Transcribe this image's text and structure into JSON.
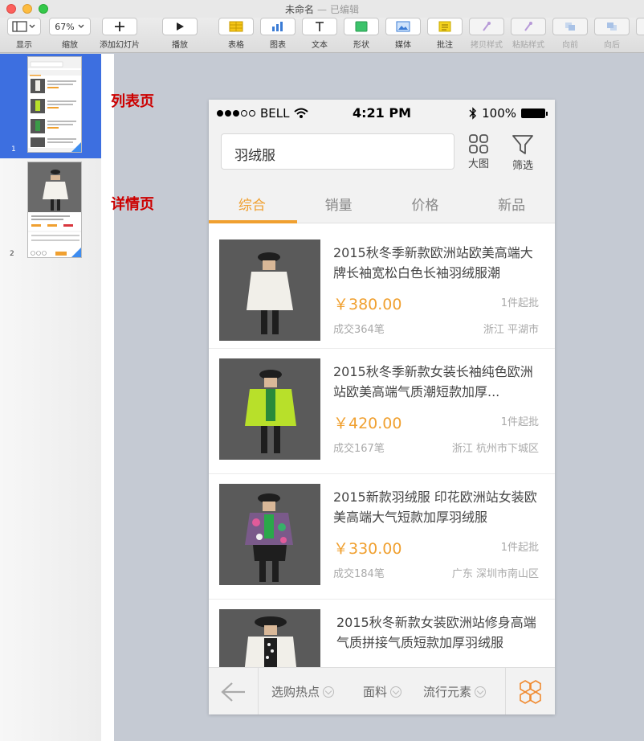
{
  "window": {
    "title": "未命名",
    "separator": "—",
    "status": "已编辑"
  },
  "toolbar": {
    "items": [
      {
        "label": "显示",
        "icon": "view-icon"
      },
      {
        "label": "缩放",
        "value": "67%"
      },
      {
        "label": "添加幻灯片",
        "icon": "plus-icon"
      },
      {
        "label": "播放",
        "icon": "play-icon"
      },
      {
        "label": "表格",
        "icon": "table-icon"
      },
      {
        "label": "图表",
        "icon": "chart-icon"
      },
      {
        "label": "文本",
        "icon": "text-icon"
      },
      {
        "label": "形状",
        "icon": "shape-icon"
      },
      {
        "label": "媒体",
        "icon": "media-icon"
      },
      {
        "label": "批注",
        "icon": "comment-icon"
      },
      {
        "label": "拷贝样式",
        "icon": "copy-style-icon"
      },
      {
        "label": "粘贴样式",
        "icon": "paste-style-icon"
      },
      {
        "label": "向前",
        "icon": "forward-icon"
      },
      {
        "label": "向后",
        "icon": "backward-icon"
      }
    ]
  },
  "navigator": {
    "slides": [
      {
        "number": "1"
      },
      {
        "number": "2"
      }
    ]
  },
  "annotations": {
    "list_page": "列表页",
    "detail_page": "详情页"
  },
  "phone": {
    "status": {
      "carrier": "BELL",
      "time": "4:21 PM",
      "battery": "100%"
    },
    "search": {
      "value": "羽绒服"
    },
    "header_buttons": {
      "grid": "大图",
      "filter": "筛选"
    },
    "tabs": [
      "综合",
      "销量",
      "价格",
      "新品"
    ],
    "items": [
      {
        "title": "2015秋冬季新款欧洲站欧美高端大牌长袖宽松白色长袖羽绒服潮",
        "price": "￥380.00",
        "min_order": "1件起批",
        "deals": "成交364笔",
        "location": "浙江 平湖市"
      },
      {
        "title": "2015秋冬季新款女装长袖纯色欧洲站欧美高端气质潮短款加厚...",
        "price": "￥420.00",
        "min_order": "1件起批",
        "deals": "成交167笔",
        "location": "浙江 杭州市下城区"
      },
      {
        "title": "2015新款羽绒服 印花欧洲站女装欧美高端大气短款加厚羽绒服",
        "price": "￥330.00",
        "min_order": "1件起批",
        "deals": "成交184笔",
        "location": "广东 深圳市南山区"
      },
      {
        "title": "2015秋冬新款女装欧洲站修身高端气质拼接气质短款加厚羽绒服",
        "price": "",
        "min_order": "",
        "deals": "",
        "location": ""
      }
    ],
    "bottom": {
      "filters": [
        "选购热点",
        "面料",
        "流行元素"
      ]
    }
  },
  "colors": {
    "accent": "#f0a030",
    "selection": "#3d6fe0",
    "annotation": "#cc0000"
  }
}
